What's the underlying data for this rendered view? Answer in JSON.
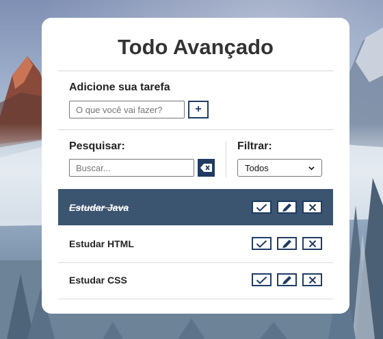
{
  "app": {
    "title": "Todo Avançado"
  },
  "add_task": {
    "label": "Adicione sua tarefa",
    "input_placeholder": "O que você vai fazer?",
    "input_value": "",
    "add_button_label": "+"
  },
  "search": {
    "label": "Pesquisar:",
    "input_placeholder": "Buscar...",
    "input_value": "",
    "clear_icon": "backspace-icon"
  },
  "filter": {
    "label": "Filtrar:",
    "selected": "Todos"
  },
  "todos": [
    {
      "text": "Estudar Java",
      "done": true
    },
    {
      "text": "Estudar HTML",
      "done": false
    },
    {
      "text": "Estudar CSS",
      "done": false
    }
  ],
  "icons": {
    "finish": "check-icon",
    "edit": "pen-icon",
    "remove": "x-icon"
  },
  "colors": {
    "accent": "#1f3b63",
    "done_row": "#3b5470",
    "card": "#ffffff"
  }
}
